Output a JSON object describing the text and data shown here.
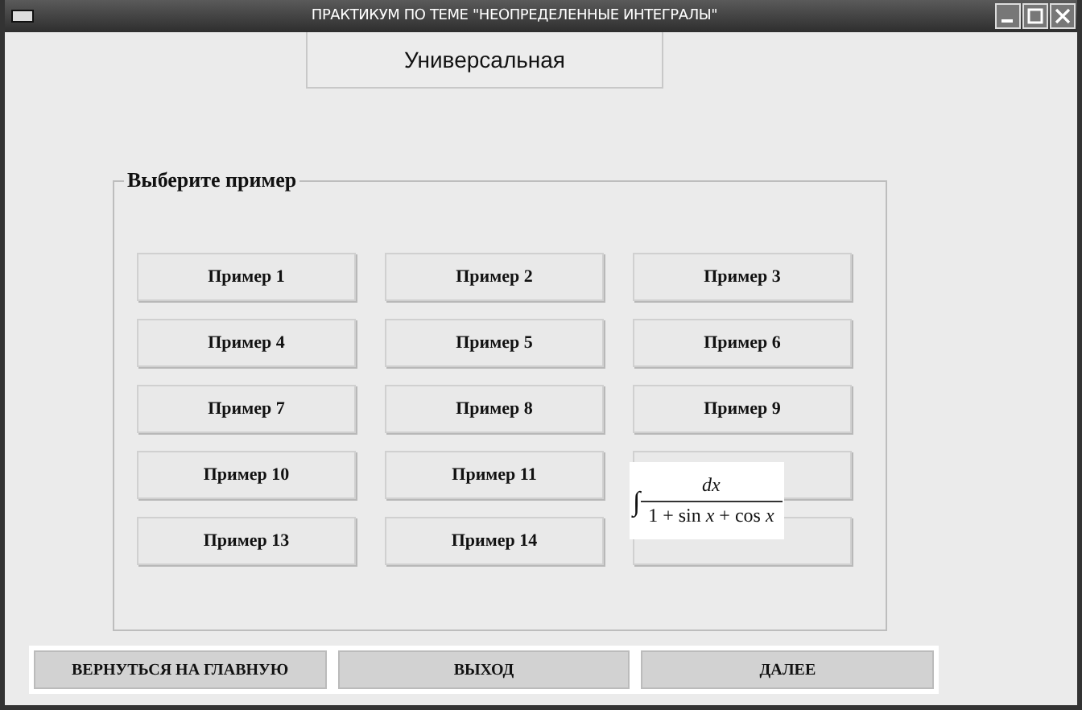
{
  "window": {
    "title": "ПРАКТИКУМ ПО ТЕМЕ \"НЕОПРЕДЕЛЕННЫЕ ИНТЕГРАЛЫ\""
  },
  "mode_button": {
    "label": "Универсальная"
  },
  "group": {
    "title": "Выберите пример",
    "examples": [
      {
        "label": "Пример 1"
      },
      {
        "label": "Пример 2"
      },
      {
        "label": "Пример 3"
      },
      {
        "label": "Пример 4"
      },
      {
        "label": "Пример 5"
      },
      {
        "label": "Пример 6"
      },
      {
        "label": "Пример 7"
      },
      {
        "label": "Пример 8"
      },
      {
        "label": "Пример 9"
      },
      {
        "label": "Пример 10"
      },
      {
        "label": "Пример 11"
      },
      {
        "covered": true
      },
      {
        "label": "Пример 13"
      },
      {
        "label": "Пример 14"
      },
      {
        "covered": true
      }
    ]
  },
  "formula_tooltip": {
    "integral": "∫",
    "numerator": "*dx*",
    "denominator": "1 + sin *x* + cos *x*"
  },
  "footer_buttons": [
    "ВЕРНУТЬСЯ НА ГЛАВНУЮ",
    "ВЫХОД",
    "ДАЛЕЕ"
  ]
}
